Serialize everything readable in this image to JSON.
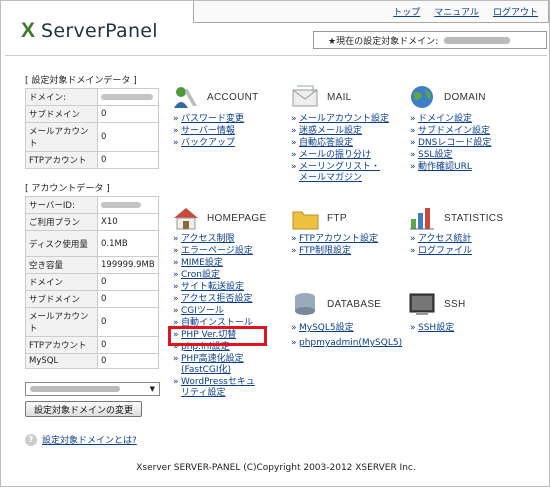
{
  "header": {
    "logo_mark": "X",
    "logo_text": "ServerPanel",
    "nav": [
      "トップ",
      "マニュアル",
      "ログアウト"
    ],
    "current_domain_label": "★現在の設定対象ドメイン:"
  },
  "domain_data": {
    "title": "[ 設定対象ドメインデータ ]",
    "rows": [
      {
        "k": "ドメイン:",
        "v": ""
      },
      {
        "k": "サブドメイン",
        "v": "0"
      },
      {
        "k": "メールアカウント",
        "v": "0"
      },
      {
        "k": "FTPアカウント",
        "v": "0"
      }
    ]
  },
  "account_data": {
    "title": "[ アカウントデータ ]",
    "rows": [
      {
        "k": "サーバーID:",
        "v": ""
      },
      {
        "k": "ご利用プラン",
        "v": "X10"
      },
      {
        "k": "ディスク使用量",
        "v": "0.1MB"
      },
      {
        "k": "空き容量",
        "v": "199999.9MB"
      },
      {
        "k": "ドメイン",
        "v": "0"
      },
      {
        "k": "サブドメイン",
        "v": "0"
      },
      {
        "k": "メールアカウント",
        "v": "0"
      },
      {
        "k": "FTPアカウント",
        "v": "0"
      },
      {
        "k": "MySQL",
        "v": "0"
      }
    ]
  },
  "select": {
    "arrow": "▼"
  },
  "change_button": "設定対象ドメインの変更",
  "help": {
    "q": "?",
    "link": "設定対象ドメインとは?"
  },
  "categories": {
    "account": {
      "label": "ACCOUNT",
      "links": [
        "パスワード変更",
        "サーバー情報",
        "バックアップ"
      ]
    },
    "mail": {
      "label": "MAIL",
      "links": [
        "メールアカウント設定",
        "迷惑メール設定",
        "自動応答設定",
        "メールの振り分け",
        "メーリングリスト・メールマガジン"
      ]
    },
    "domain": {
      "label": "DOMAIN",
      "links": [
        "ドメイン設定",
        "サブドメイン設定",
        "DNSレコード設定",
        "SSL設定",
        "動作確認URL"
      ]
    },
    "homepage": {
      "label": "HOMEPAGE",
      "links": [
        "アクセス制限",
        "エラーページ設定",
        "MIME設定",
        "Cron設定",
        "サイト転送設定",
        "アクセス拒否設定",
        "CGIツール",
        "自動インストール",
        "PHP Ver.切替",
        "php.ini設定",
        "PHP高速化設定(FastCGI化)",
        "WordPressセキュリティ設定"
      ]
    },
    "ftp": {
      "label": "FTP",
      "links": [
        "FTPアカウント設定",
        "FTP制限設定"
      ]
    },
    "statistics": {
      "label": "STATISTICS",
      "links": [
        "アクセス統計",
        "ログファイル"
      ]
    },
    "database": {
      "label": "DATABASE",
      "links": [
        "MySQL5設定",
        "phpmyadmin(MySQL5)"
      ]
    },
    "ssh": {
      "label": "SSH",
      "links": [
        "SSH設定"
      ]
    }
  },
  "footer": "Xserver SERVER-PANEL (C)Copyright 2003-2012 XSERVER Inc.",
  "colors": {
    "link": "#0b3e8c",
    "highlight": "#e0141e",
    "logo_green": "#3b7a2a"
  }
}
